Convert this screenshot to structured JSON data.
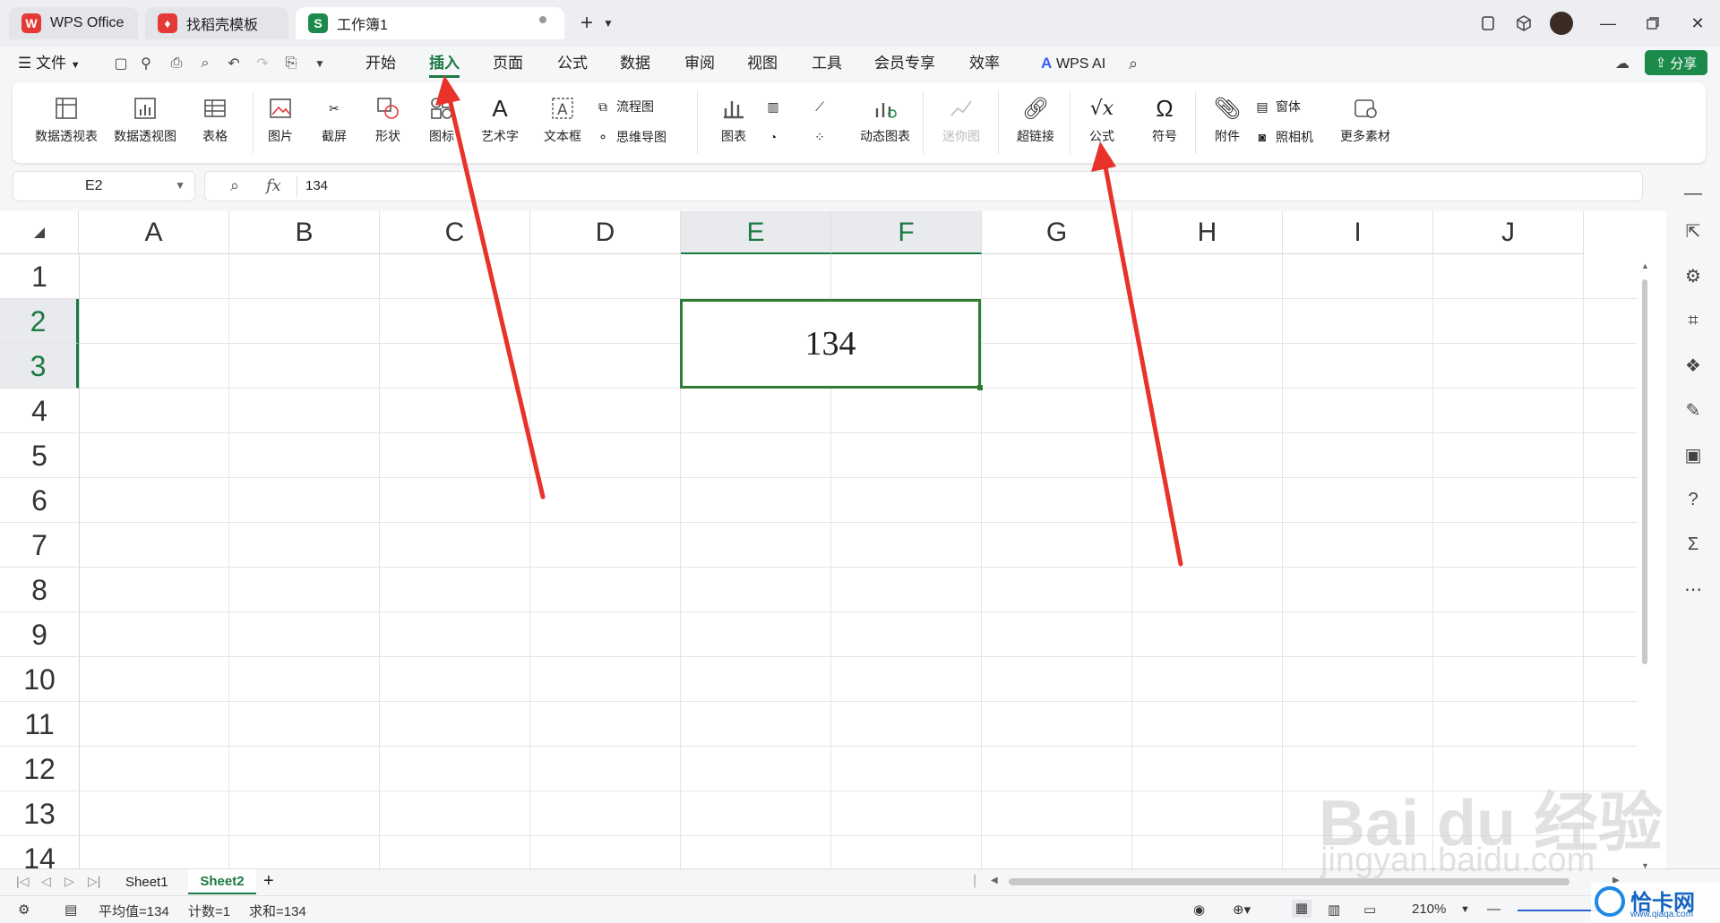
{
  "titlebar": {
    "tabs": [
      {
        "label": "WPS Office",
        "logo": "W",
        "logo_color": "#e53935"
      },
      {
        "label": "找稻壳模板",
        "logo": "♦",
        "logo_color": "#e53935"
      },
      {
        "label": "工作簿1",
        "logo": "S",
        "logo_color": "#1b8a4a"
      }
    ],
    "new_tab": "+"
  },
  "menubar": {
    "file": "文件",
    "items": [
      "开始",
      "插入",
      "页面",
      "公式",
      "数据",
      "审阅",
      "视图",
      "工具",
      "会员专享",
      "效率"
    ],
    "active_item": "插入",
    "wps_ai": "WPS AI",
    "share": "分享"
  },
  "ribbon": {
    "big": [
      "数据透视表",
      "数据透视图",
      "表格",
      "图片",
      "截屏",
      "形状",
      "图标",
      "艺术字",
      "文本框"
    ],
    "flow": "流程图",
    "mind": "思维导图",
    "chart": "图表",
    "dynamic_chart": "动态图表",
    "sparkline": "迷你图",
    "hyperlink": "超链接",
    "formula": "公式",
    "symbol": "符号",
    "attachment": "附件",
    "form": "窗体",
    "camera": "照相机",
    "more": "更多素材"
  },
  "formula_bar": {
    "name_box": "E2",
    "fx": "fx",
    "content": "134"
  },
  "grid": {
    "columns": [
      "A",
      "B",
      "C",
      "D",
      "E",
      "F",
      "G",
      "H",
      "I",
      "J"
    ],
    "rows": [
      "1",
      "2",
      "3",
      "4",
      "5",
      "6",
      "7",
      "8",
      "9",
      "10",
      "11",
      "12",
      "13",
      "14"
    ],
    "selected_columns": [
      "E",
      "F"
    ],
    "selected_rows": [
      "2",
      "3"
    ],
    "merged_cell_value": "134",
    "accent": "#1b7a43"
  },
  "sheets": {
    "tabs": [
      "Sheet1",
      "Sheet2"
    ],
    "active": "Sheet2",
    "add": "+"
  },
  "status": {
    "average": "平均值=134",
    "count": "计数=1",
    "sum": "求和=134",
    "zoom": "210%"
  },
  "watermarks": {
    "baidu": "Bai du 经验",
    "url": "jingyan.baidu.com",
    "corner": "恰卡网",
    "corner_url": "www.qiaqa.com"
  }
}
